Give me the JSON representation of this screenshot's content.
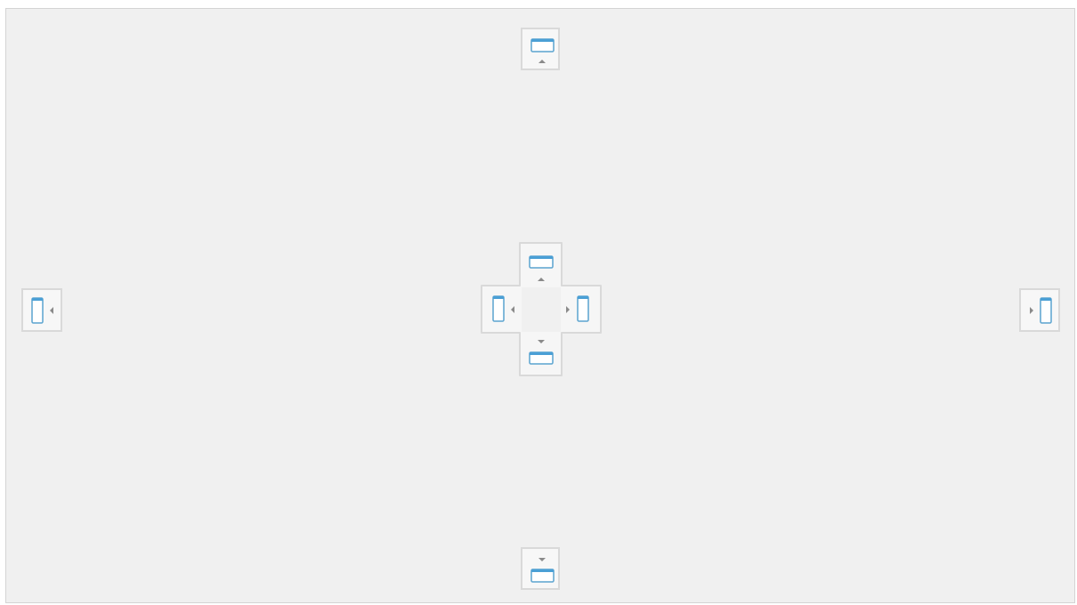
{
  "window": {
    "title": ""
  },
  "dock_guides": {
    "outer": [
      {
        "position": "top",
        "icon": "dock-top-icon"
      },
      {
        "position": "bottom",
        "icon": "dock-bottom-icon"
      },
      {
        "position": "left",
        "icon": "dock-left-icon"
      },
      {
        "position": "right",
        "icon": "dock-right-icon"
      }
    ],
    "center_cross": [
      {
        "position": "top",
        "icon": "dock-top-icon"
      },
      {
        "position": "bottom",
        "icon": "dock-bottom-icon"
      },
      {
        "position": "left",
        "icon": "dock-left-icon"
      },
      {
        "position": "right",
        "icon": "dock-right-icon"
      },
      {
        "position": "center",
        "icon": "dock-fill-icon"
      }
    ]
  },
  "colors": {
    "surface": "#f0f0f0",
    "guide_background": "#f7f7f7",
    "guide_border": "#d9d9d9",
    "pane_accent": "#4a9fd5",
    "pane_outline": "#5aa3cf",
    "arrow": "#8a8a8a"
  }
}
